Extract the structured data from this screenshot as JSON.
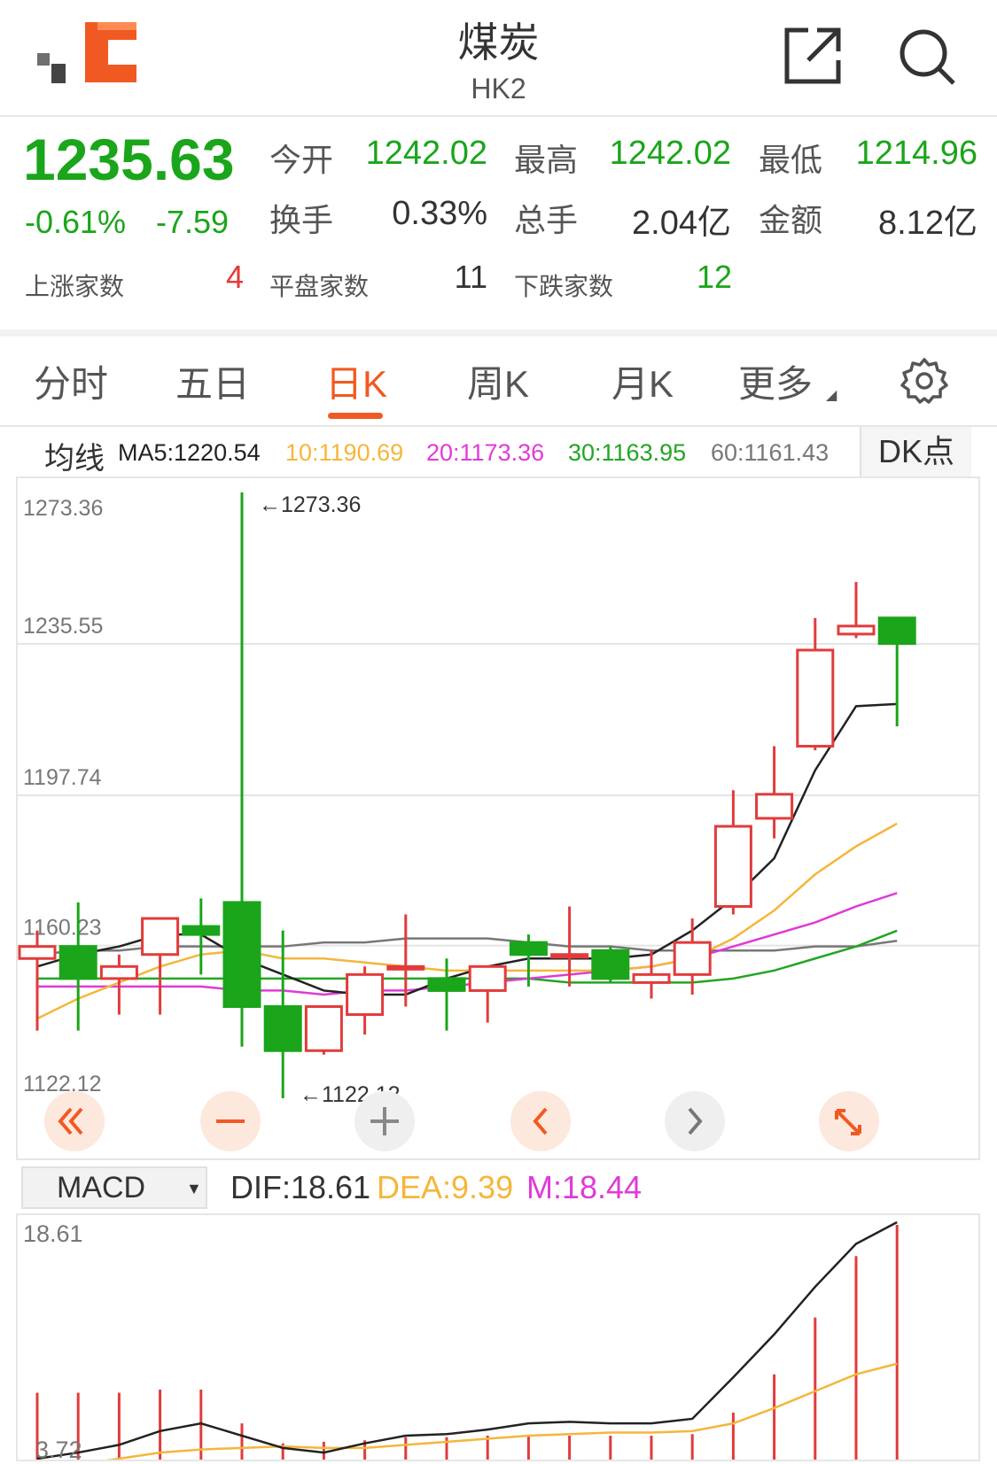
{
  "header": {
    "title": "煤炭",
    "subtitle": "HK2"
  },
  "quote": {
    "price": "1235.63",
    "change_pct": "-0.61%",
    "change_abs": "-7.59",
    "open_label": "今开",
    "open": "1242.02",
    "high_label": "最高",
    "high": "1242.02",
    "low_label": "最低",
    "low": "1214.96",
    "turnover_label": "换手",
    "turnover": "0.33%",
    "volume_label": "总手",
    "volume": "2.04亿",
    "amount_label": "金额",
    "amount": "8.12亿",
    "up_label": "上涨家数",
    "up": "4",
    "flat_label": "平盘家数",
    "flat": "11",
    "down_label": "下跌家数",
    "down": "12"
  },
  "tabs": [
    "分时",
    "五日",
    "日K",
    "周K",
    "月K",
    "更多"
  ],
  "active_tab": "日K",
  "ma": {
    "label": "均线",
    "ma5": "MA5:1220.54",
    "ma10": "10:1190.69",
    "ma20": "20:1173.36",
    "ma30": "30:1163.95",
    "ma60": "60:1161.43",
    "dk_button": "DK点"
  },
  "colors": {
    "up": "#e23b3b",
    "down": "#1aa51a",
    "ma5": "#222222",
    "ma10": "#f5b63a",
    "ma20": "#e03ad8",
    "ma30": "#23a523",
    "ma60": "#777777",
    "accent": "#f05a22"
  },
  "kchart": {
    "ticks": [
      "1273.36",
      "1235.55",
      "1197.74",
      "1160.23"
    ],
    "bottom": "1122.12",
    "max_label": "←1273.36",
    "min_label": "←1122.12"
  },
  "macd": {
    "select": "MACD",
    "dif": "DIF:18.61",
    "dea": "DEA:9.39",
    "m": "M:18.44",
    "top": "18.61",
    "bottom": "3.72"
  },
  "chart_data": {
    "type": "candlestick",
    "ylim": [
      1122.12,
      1273.36
    ],
    "candles": [
      {
        "o": 1157,
        "c": 1160,
        "h": 1164,
        "l": 1139
      },
      {
        "o": 1160,
        "c": 1152,
        "h": 1171,
        "l": 1139
      },
      {
        "o": 1152,
        "c": 1155,
        "h": 1158,
        "l": 1143
      },
      {
        "o": 1158,
        "c": 1167,
        "h": 1167,
        "l": 1143
      },
      {
        "o": 1165,
        "c": 1163,
        "h": 1172,
        "l": 1153
      },
      {
        "o": 1171,
        "c": 1145,
        "h": 1273.36,
        "l": 1135
      },
      {
        "o": 1145,
        "c": 1134,
        "h": 1164,
        "l": 1122.12
      },
      {
        "o": 1134,
        "c": 1145,
        "h": 1145,
        "l": 1133
      },
      {
        "o": 1143,
        "c": 1153,
        "h": 1155,
        "l": 1138
      },
      {
        "o": 1155,
        "c": 1155,
        "h": 1168,
        "l": 1145
      },
      {
        "o": 1152,
        "c": 1149,
        "h": 1157,
        "l": 1139
      },
      {
        "o": 1149,
        "c": 1155,
        "h": 1155,
        "l": 1141
      },
      {
        "o": 1161,
        "c": 1158,
        "h": 1163,
        "l": 1150
      },
      {
        "o": 1158,
        "c": 1158,
        "h": 1170,
        "l": 1150
      },
      {
        "o": 1159,
        "c": 1152,
        "h": 1160,
        "l": 1151
      },
      {
        "o": 1151,
        "c": 1153,
        "h": 1159,
        "l": 1147
      },
      {
        "o": 1153,
        "c": 1161,
        "h": 1167,
        "l": 1148
      },
      {
        "o": 1170,
        "c": 1190,
        "h": 1199,
        "l": 1168
      },
      {
        "o": 1192,
        "c": 1198,
        "h": 1210,
        "l": 1187
      },
      {
        "o": 1210,
        "c": 1234,
        "h": 1242,
        "l": 1209
      },
      {
        "o": 1238,
        "c": 1240,
        "h": 1251,
        "l": 1237
      },
      {
        "o": 1242.02,
        "c": 1235.63,
        "h": 1242.02,
        "l": 1214.96
      }
    ],
    "ma5": [
      1155,
      1158,
      1160,
      1163,
      1163,
      1157,
      1153,
      1149,
      1148,
      1148,
      1152,
      1155,
      1157,
      1157,
      1157,
      1158,
      1164,
      1172,
      1182,
      1204,
      1220,
      1220.54
    ],
    "ma10": [
      1142,
      1147,
      1151,
      1155,
      1158,
      1159,
      1157,
      1157,
      1156,
      1155,
      1154,
      1154,
      1154,
      1154,
      1154,
      1155,
      1157,
      1162,
      1169,
      1178,
      1185,
      1190.69
    ],
    "ma20": [
      1150,
      1150,
      1150,
      1150,
      1150,
      1149,
      1149,
      1148,
      1149,
      1149,
      1150,
      1151,
      1152,
      1153,
      1154,
      1155,
      1157,
      1160,
      1163,
      1166,
      1170,
      1173.36
    ],
    "ma30": [
      1152,
      1152,
      1152,
      1152,
      1152,
      1152,
      1152,
      1152,
      1152,
      1152,
      1152,
      1152,
      1152,
      1151,
      1151,
      1151,
      1151,
      1152,
      1154,
      1157,
      1160,
      1163.95
    ],
    "ma60": [
      1158,
      1159,
      1159,
      1160,
      1160,
      1160,
      1160,
      1161,
      1161,
      1162,
      1162,
      1162,
      1161,
      1160,
      1160,
      1159,
      1159,
      1159,
      1159,
      1160,
      1160,
      1161.43
    ],
    "macd_range": [
      3.72,
      18.61
    ],
    "dif": [
      3.2,
      3.6,
      4.1,
      5.0,
      5.5,
      4.7,
      3.9,
      3.6,
      4.2,
      4.7,
      4.8,
      5.1,
      5.5,
      5.6,
      5.5,
      5.5,
      5.8,
      8.5,
      11.3,
      14.4,
      17.2,
      18.61
    ],
    "dea": [
      2.4,
      2.8,
      3.2,
      3.6,
      3.8,
      3.9,
      4.0,
      3.9,
      3.9,
      4.1,
      4.3,
      4.5,
      4.7,
      4.8,
      4.9,
      4.9,
      5.0,
      5.5,
      6.5,
      7.6,
      8.7,
      9.39
    ],
    "macd_bar": [
      7.5,
      7.5,
      7.5,
      7.7,
      7.7,
      5.5,
      4.2,
      4.3,
      4.4,
      4.6,
      4.6,
      4.7,
      4.7,
      4.7,
      4.7,
      4.7,
      4.8,
      6.2,
      8.7,
      12.4,
      16.4,
      18.44
    ]
  }
}
